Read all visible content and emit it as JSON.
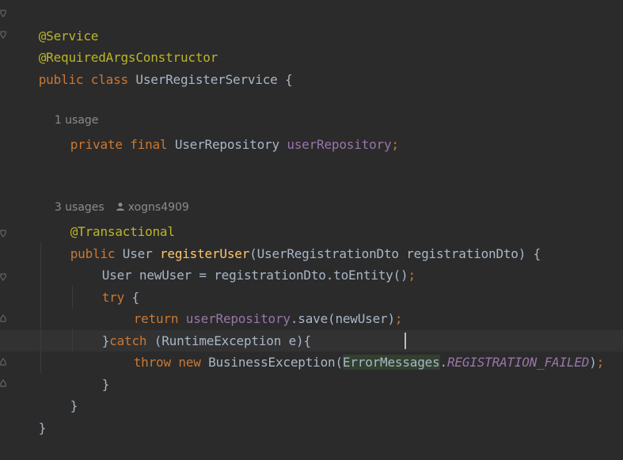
{
  "editor": {
    "lines": {
      "l1": "@Service",
      "l2": "@RequiredArgsConstructor",
      "l3_public": "public",
      "l3_class": "class",
      "l3_name": "UserRegisterService",
      "l3_brace": "{",
      "hint1": "1 usage",
      "l5_private": "private",
      "l5_final": "final",
      "l5_type": "UserRepository",
      "l5_field": "userRepository",
      "l5_semi": ";",
      "hint2_usages": "3 usages",
      "hint2_author": "xogns4909",
      "l7": "@Transactional",
      "l8_public": "public",
      "l8_type": "User",
      "l8_method": "registerUser",
      "l8_params": "(UserRegistrationDto registrationDto) {",
      "l9_code": "User newUser = registrationDto.toEntity()",
      "l9_semi": ";",
      "l10_try": "try",
      "l10_brace": "{",
      "l11_return": "return",
      "l11_field": "userRepository",
      "l11_call": ".save(newUser)",
      "l11_semi": ";",
      "l12_close": "}",
      "l12_catch": "catch",
      "l12_rest": "(RuntimeException e){",
      "l13_throw": "throw",
      "l13_new": "new",
      "l13_ex": "BusinessException(",
      "l13_errmsg": "ErrorMessages",
      "l13_dot": ".",
      "l13_const": "REGISTRATION_FAILED",
      "l13_paren": ")",
      "l13_semi": ";",
      "l14": "}",
      "l15": "}",
      "l16": "}"
    }
  }
}
